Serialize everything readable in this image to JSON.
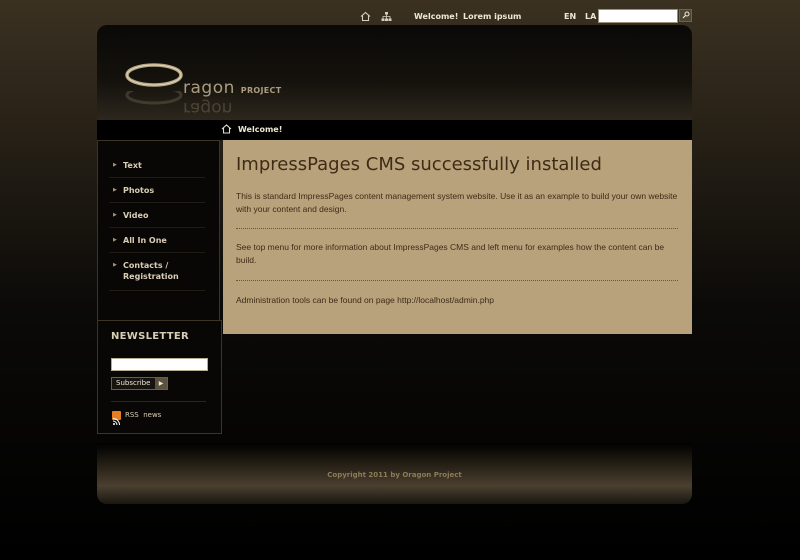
{
  "topbar": {
    "home_icon": "home-icon",
    "sitemap_icon": "sitemap-icon",
    "links": [
      "Welcome!",
      "Lorem ipsum"
    ],
    "languages": [
      "EN",
      "LA"
    ],
    "search_icon": "search-icon"
  },
  "header": {
    "logo_main": "ragon",
    "logo_sub": "PROJECT"
  },
  "breadcrumb": {
    "icon": "home-icon",
    "label": "Welcome!"
  },
  "menu": {
    "items": [
      "Text",
      "Photos",
      "Video",
      "All In One",
      "Contacts /\nRegistration"
    ]
  },
  "newsletter": {
    "title": "NEWSLETTER",
    "button_label": "Subscribe",
    "rss_label": "RSS  news"
  },
  "content": {
    "title": "ImpressPages CMS successfully installed",
    "paragraphs": [
      "This is standard ImpressPages content management system website. Use it as an example to build your own website with your content and design.",
      "See top menu for more information about ImpressPages CMS and left menu for examples how the content can be build.",
      "Administration tools can be found on page http://localhost/admin.php"
    ]
  },
  "footer": {
    "copyright": "Copyright 2011 by Oragon Project"
  },
  "colors": {
    "content_bg": "#b8a27c",
    "text_dark": "#3e2b15",
    "menu_text": "#d9cdb5",
    "page_bg": "#000000"
  }
}
